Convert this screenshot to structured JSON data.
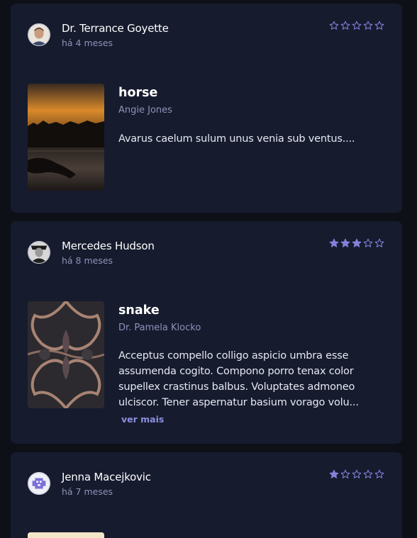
{
  "colors": {
    "background": "#0d1117",
    "card": "#161b2e",
    "star_filled": "#8381d8",
    "star_empty": "#8381d8",
    "muted_text": "#8f93b8",
    "link": "#8c8fe0"
  },
  "reviews": [
    {
      "author": "Dr. Terrance Goyette",
      "time": "há 4 meses",
      "rating": 0,
      "book_title": "horse",
      "book_author": "Angie Jones",
      "text": "Avarus caelum sulum unus venia sub ventus....",
      "more_label": ""
    },
    {
      "author": "Mercedes Hudson",
      "time": "há 8 meses",
      "rating": 3,
      "book_title": "snake",
      "book_author": "Dr. Pamela Klocko",
      "text": "Acceptus compello colligo aspicio umbra esse assumenda cogito. Compono porro tenax color supellex crastinus balbus. Voluptates admoneo ulciscor. Tener aspernatur basium vorago volu...",
      "more_label": "ver mais"
    },
    {
      "author": "Jenna Macejkovic",
      "time": "há 7 meses",
      "rating": 1,
      "book_title": "",
      "book_author": "",
      "text": "",
      "more_label": ""
    }
  ]
}
